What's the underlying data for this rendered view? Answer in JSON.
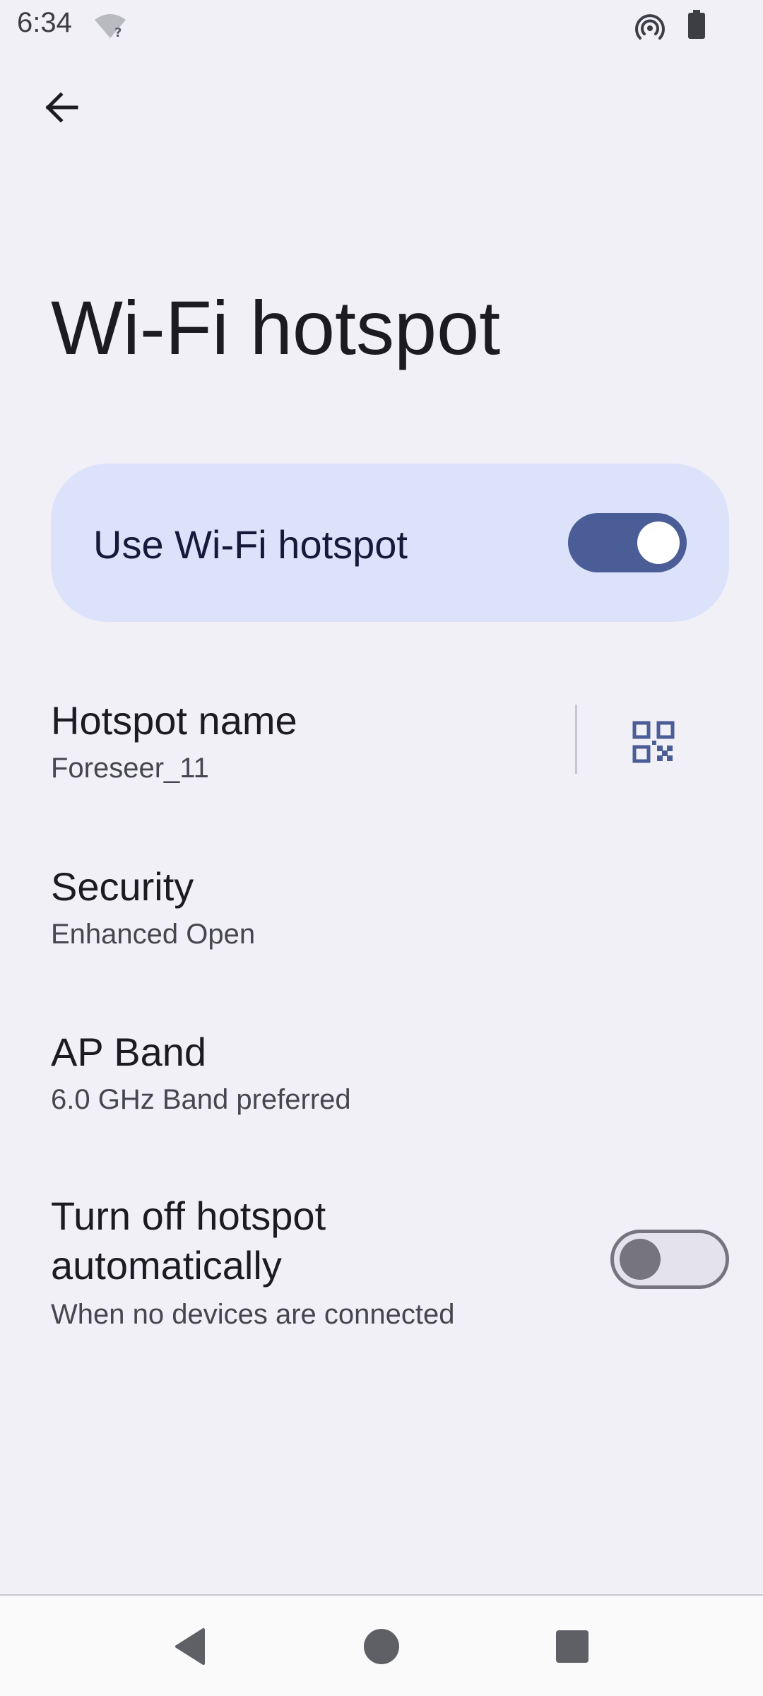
{
  "status_bar": {
    "time": "6:34",
    "icons": [
      "wifi-no-internet-icon",
      "hotspot-icon",
      "battery-icon"
    ]
  },
  "header": {
    "back_icon": "arrow-back-icon",
    "title": "Wi-Fi hotspot"
  },
  "main_toggle": {
    "label": "Use Wi-Fi hotspot",
    "checked": true
  },
  "settings": {
    "hotspot_name": {
      "title": "Hotspot name",
      "summary": "Foreseer_11",
      "action_icon": "qr-code-icon"
    },
    "security": {
      "title": "Security",
      "summary": "Enhanced Open"
    },
    "ap_band": {
      "title": "AP Band",
      "summary": "6.0 GHz Band preferred"
    },
    "auto_off": {
      "title": "Turn off hotspot automatically",
      "summary": "When no devices are connected",
      "checked": false
    }
  },
  "nav_bar": {
    "icons": [
      "nav-back-icon",
      "nav-home-icon",
      "nav-recents-icon"
    ]
  },
  "colors": {
    "background": "#f1f0f7",
    "card": "#dce2fa",
    "accent": "#4b5d96",
    "text_primary": "#1b1b21",
    "text_secondary": "#46464f"
  }
}
